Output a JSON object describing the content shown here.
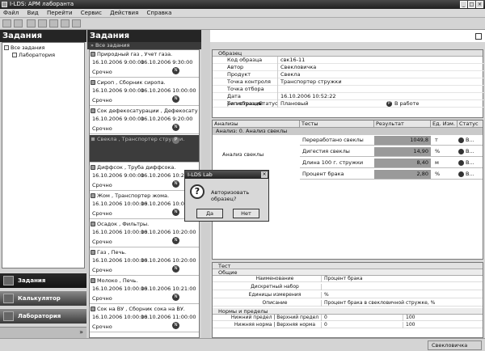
{
  "window": {
    "title": "I-LDS: АРМ лаборанта",
    "btn_min": "_",
    "btn_max": "□",
    "btn_close": "×"
  },
  "menu": [
    "Файл",
    "Вид",
    "Перейти",
    "Сервис",
    "Действия",
    "Справка"
  ],
  "left": {
    "title": "Задания",
    "tree_root": "Все задания",
    "tree_child": "Лаборатория",
    "nav": [
      "Задания",
      "Калькулятор",
      "Лаборатория"
    ],
    "nav_more": "»"
  },
  "middle": {
    "title": "Задания",
    "breadcrumb": "» Все задания",
    "items": [
      {
        "title": "Природный газ , Учет газа.",
        "d1": "16.10.2006 9:00:00",
        "d2": "16.10.2006 9:30:00",
        "urgency": "Срочно",
        "badge": "N"
      },
      {
        "title": "Сироп , Сборник сиропа.",
        "d1": "16.10.2006 9:00:00",
        "d2": "16.10.2006 10:00:00",
        "urgency": "Срочно",
        "badge": "N"
      },
      {
        "title": "Сок дефекосатурации , Дефекосату...",
        "d1": "16.10.2006 9:00:00",
        "d2": "16.10.2006 9:20:00",
        "urgency": "Срочно",
        "badge": "N"
      },
      {
        "title": "Свекла , Транспортер стружки.",
        "d1": "",
        "d2": "",
        "urgency": "",
        "badge": "P"
      },
      {
        "title": "Диффсок , Труба диффсока.",
        "d1": "16.10.2006 9:00:00",
        "d2": "16.10.2006 10:2",
        "urgency": "Срочно",
        "badge": "N"
      },
      {
        "title": "Жом , Транспортер жома.",
        "d1": "16.10.2006 10:00:00",
        "d2": "16.10.2006 10:00:00",
        "urgency": "Срочно",
        "badge": "N"
      },
      {
        "title": "Осадок , Фильтры.",
        "d1": "16.10.2006 10:00:00",
        "d2": "16.10.2006 10:20:00",
        "urgency": "Срочно",
        "badge": "N"
      },
      {
        "title": "Газ , Печь.",
        "d1": "16.10.2006 10:00:00",
        "d2": "16.10.2006 10:20:00",
        "urgency": "Срочно",
        "badge": "N"
      },
      {
        "title": "Молоко , Печь.",
        "d1": "16.10.2006 10:00:00",
        "d2": "16.10.2006 10:21:00",
        "urgency": "Срочно",
        "badge": "N"
      },
      {
        "title": "Сок на ВУ , Сборник сока на ВУ.",
        "d1": "16.10.2006 10:00:00",
        "d2": "16.10.2006 11:00:00",
        "urgency": "Срочно",
        "badge": "N"
      }
    ]
  },
  "sample": {
    "header": "Образец",
    "fields": [
      {
        "k": "Код образца",
        "v": "свк16-11"
      },
      {
        "k": "Автор",
        "v": "Свекловичка"
      },
      {
        "k": "Продукт",
        "v": "Свекла"
      },
      {
        "k": "Точка контроля",
        "v": "Транспортер стружки"
      },
      {
        "k": "Точка отбора",
        "v": ""
      },
      {
        "k": "Дата регистрации",
        "v": "16.10.2006 10:52:22"
      }
    ],
    "type_label": "Тип образца",
    "status_label": "Статус",
    "type_value": "Плановый",
    "status_value": "В работе",
    "status_badge": "P"
  },
  "analyses": {
    "cols": [
      "Анализы",
      "Тесты",
      "Результат",
      "Ед. Изм.",
      "Статус"
    ],
    "group": "Анализ: 0. Анализ свеклы",
    "name": "Анализ свеклы",
    "rows": [
      {
        "test": "Переработано свеклы",
        "res": "1049,8",
        "unit": "т",
        "st": "В..."
      },
      {
        "test": "Дигестия свеклы",
        "res": "14,90",
        "unit": "%",
        "st": "В..."
      },
      {
        "test": "Длина 100 г. стружки",
        "res": "8,40",
        "unit": "м",
        "st": "В..."
      },
      {
        "test": "Процент брака",
        "res": "2,80",
        "unit": "%",
        "st": "В..."
      }
    ]
  },
  "test": {
    "header": "Тест",
    "common": "Общие",
    "fields": [
      {
        "k": "Наименование",
        "v": "Процент брака"
      },
      {
        "k": "Дискретный набор",
        "v": ""
      },
      {
        "k": "Единицы измерения",
        "v": "%"
      },
      {
        "k": "Описание",
        "v": "Процент брака в свекловичной стружке, %"
      }
    ],
    "limits": "Нормы и пределы",
    "lrows": [
      {
        "k": "Нижний предел  |  Верхний предел",
        "v": "0",
        "v2": "100"
      },
      {
        "k": "Нижняя норма  |  Верхняя норма",
        "v": "0",
        "v2": "100"
      }
    ]
  },
  "dialog": {
    "title": "I-LDS Lab",
    "close": "×",
    "question_icon": "?",
    "text": "Авторизовать образец?",
    "yes": "Да",
    "no": "Нет"
  },
  "status": {
    "user": "Свекловичка"
  }
}
